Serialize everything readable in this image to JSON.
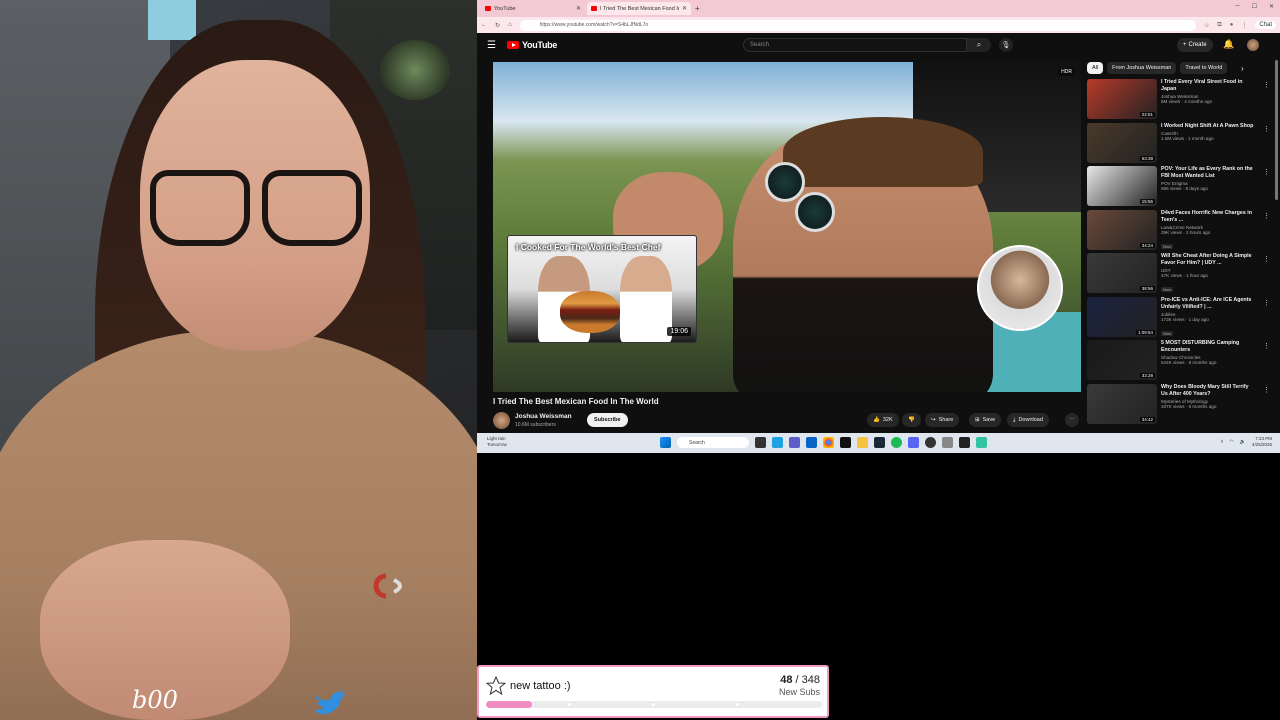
{
  "browser": {
    "tabs": [
      {
        "label": "YouTube"
      },
      {
        "label": "I Tried The Best Mexican Food In The World"
      }
    ],
    "url": "https://www.youtube.com/watch?v=S4bLJfNdL7o",
    "chat_label": "Chat"
  },
  "youtube": {
    "logo_text": "YouTube",
    "search_placeholder": "Search",
    "create_label": "Create",
    "player": {
      "badge": "HDR",
      "endcard_title": "I Cooked For The World's Best Chef",
      "endcard_duration": "19:06"
    },
    "video": {
      "title": "I Tried The Best Mexican Food In The World",
      "channel": "Joshua Weissman",
      "subscribers": "10.6M subscribers",
      "subscribe_label": "Subscribe",
      "like_count": "32K",
      "share_label": "Share",
      "save_label": "Save",
      "download_label": "Download"
    },
    "chips": [
      "All",
      "From Joshua Weissman",
      "Travel to World"
    ],
    "recommendations": [
      {
        "title": "I Tried Every Viral Street Food in Japan",
        "channel": "Joshua Weissman",
        "views": "5M views · 4 months ago",
        "duration": "22:51",
        "color": "#b83a2a",
        "new": false
      },
      {
        "title": "I Worked Night Shift At A Pawn Shop",
        "channel": "CaseOh",
        "views": "1.5M views · 1 month ago",
        "duration": "53:38",
        "color": "#4a3a2a",
        "new": false
      },
      {
        "title": "POV: Your Life as Every Rank on the FBI Most Wanted List",
        "channel": "POV Enigma",
        "views": "696 views · 8 days ago",
        "duration": "15:55",
        "color": "#e8e8e8",
        "new": false
      },
      {
        "title": "D4vd Faces Horrific New Charges in Teen's ...",
        "channel": "Law&Crime Network",
        "views": "29K views · 2 hours ago",
        "duration": "34:24",
        "color": "#6a4a3a",
        "new": true
      },
      {
        "title": "Will She Cheat After Doing A Simple Favor For Him? | UDY ...",
        "channel": "UDY",
        "views": "47K views · 1 hour ago",
        "duration": "38:56",
        "color": "#3a3a3a",
        "new": true
      },
      {
        "title": "Pro-ICE vs Anti-ICE: Are ICE Agents Unfairly Vilified? | ...",
        "channel": "Jubilee",
        "views": "173K views · 1 day ago",
        "duration": "1:09:54",
        "color": "#1a2240",
        "new": true
      },
      {
        "title": "5 MOST DISTURBING Camping Encounters",
        "channel": "Shadow Chronicles",
        "views": "544K views · 8 months ago",
        "duration": "33:28",
        "color": "#1a1a1a",
        "new": false
      },
      {
        "title": "Why Does Bloody Mary Still Terrify Us After 400 Years?",
        "channel": "Mysteries of Mythology",
        "views": "337K views · 6 months ago",
        "duration": "34:42",
        "color": "#3a3a3a",
        "new": false
      }
    ]
  },
  "taskbar": {
    "weather_line1": "Light rain",
    "weather_line2": "Tomorrow",
    "search_label": "Search",
    "time": "7:23 PM",
    "date": "4/25/2026"
  },
  "overlay": {
    "boo_text": "b00",
    "goal_label": "new tattoo :)",
    "goal_current": "48",
    "goal_total": "348",
    "goal_unit": "New Subs",
    "goal_progress": 0.138
  }
}
